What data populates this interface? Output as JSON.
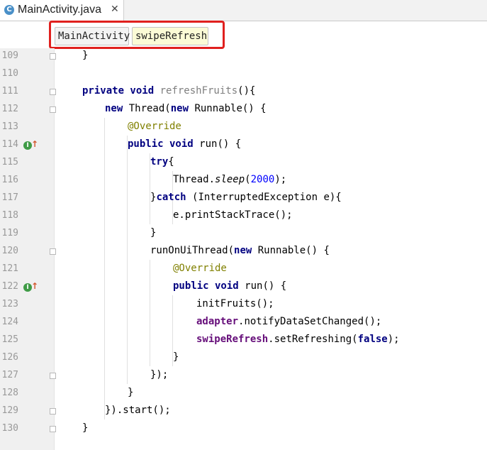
{
  "tab": {
    "icon": "C",
    "title": "MainActivity.java",
    "close": "✕"
  },
  "breadcrumbs": [
    {
      "label": "MainActivity"
    },
    {
      "label": "swipeRefresh"
    }
  ],
  "gutter": {
    "line_numbers": [
      "109",
      "110",
      "111",
      "112",
      "113",
      "114",
      "115",
      "116",
      "117",
      "118",
      "119",
      "120",
      "121",
      "122",
      "123",
      "124",
      "125",
      "126",
      "127",
      "128",
      "129",
      "130"
    ],
    "implements_marker": "I"
  },
  "code": {
    "l109": {
      "a": "}"
    },
    "l111": {
      "a": "private void ",
      "b": "refreshFruits",
      "c": "(){"
    },
    "l112": {
      "a": "new ",
      "b": "Thread(",
      "c": "new ",
      "d": "Runnable() {"
    },
    "l113": {
      "a": "@Override"
    },
    "l114": {
      "a": "public void ",
      "b": "run() {"
    },
    "l115": {
      "a": "try",
      "b": "{"
    },
    "l116": {
      "a": "Thread.",
      "b": "sleep",
      "c": "(",
      "d": "2000",
      "e": ");"
    },
    "l117": {
      "a": "}",
      "b": "catch ",
      "c": "(InterruptedException e){"
    },
    "l118": {
      "a": "e.printStackTrace();"
    },
    "l119": {
      "a": "}"
    },
    "l120": {
      "a": "runOnUiThread(",
      "b": "new ",
      "c": "Runnable() {"
    },
    "l121": {
      "a": "@Override"
    },
    "l122": {
      "a": "public void ",
      "b": "run() {"
    },
    "l123": {
      "a": "initFruits();"
    },
    "l124": {
      "a": "adapter",
      "b": ".notifyDataSetChanged();"
    },
    "l125": {
      "a": "swipeRefresh",
      "b": ".setRefreshing(",
      "c": "false",
      "d": ");"
    },
    "l126": {
      "a": "}"
    },
    "l127": {
      "a": "});"
    },
    "l128": {
      "a": "}"
    },
    "l129": {
      "a": "}).start();"
    },
    "l130": {
      "a": "}"
    }
  }
}
